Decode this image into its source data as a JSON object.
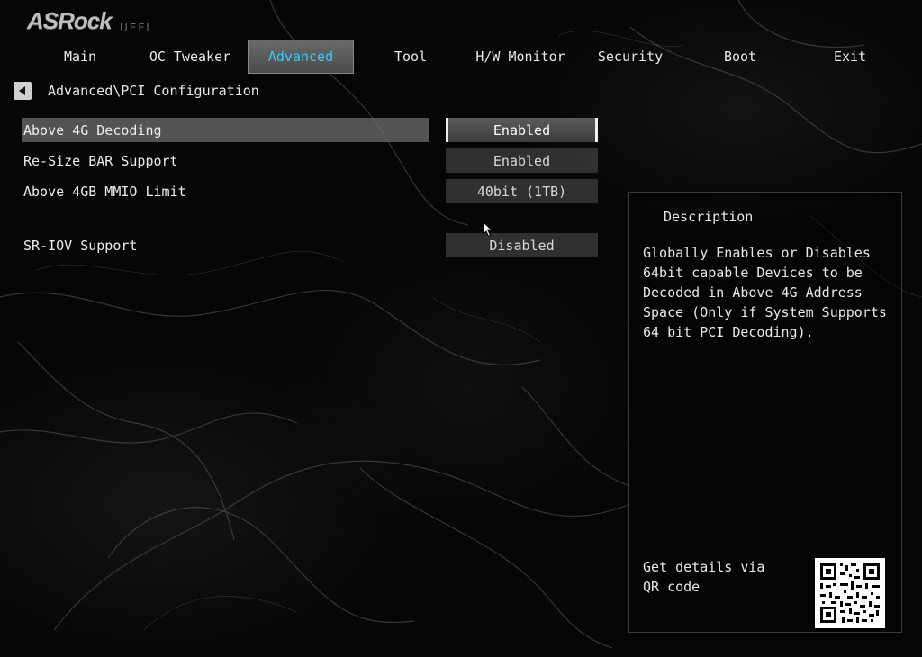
{
  "brand": {
    "logo": "ASRock",
    "sub": "UEFI"
  },
  "tabs": [
    {
      "label": "Main",
      "active": false
    },
    {
      "label": "OC Tweaker",
      "active": false
    },
    {
      "label": "Advanced",
      "active": true
    },
    {
      "label": "Tool",
      "active": false
    },
    {
      "label": "H/W Monitor",
      "active": false
    },
    {
      "label": "Security",
      "active": false
    },
    {
      "label": "Boot",
      "active": false
    },
    {
      "label": "Exit",
      "active": false
    }
  ],
  "breadcrumb": {
    "path": "Advanced\\PCI Configuration"
  },
  "settings": [
    {
      "label": "Above 4G Decoding",
      "value": "Enabled",
      "selected": true
    },
    {
      "label": "Re-Size BAR Support",
      "value": "Enabled",
      "selected": false
    },
    {
      "label": "Above 4GB MMIO Limit",
      "value": "40bit (1TB)",
      "selected": false
    },
    {
      "label": "SR-IOV Support",
      "value": "Disabled",
      "selected": false
    }
  ],
  "description": {
    "title": "Description",
    "text": "Globally Enables or Disables 64bit capable Devices to be Decoded in Above 4G Address Space (Only if System Supports 64 bit PCI Decoding).",
    "qr_text": "Get details via QR code"
  },
  "colors": {
    "accent": "#33ccff",
    "selected_row": "#6e6e6e"
  }
}
